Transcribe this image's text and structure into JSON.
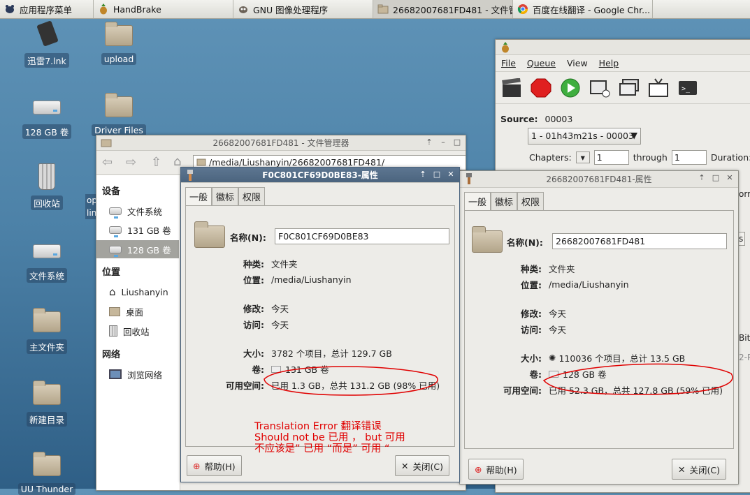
{
  "taskbar": {
    "menu": "应用程序菜单",
    "items": [
      "HandBrake",
      "GNU 图像处理程序",
      "26682007681FD481 - 文件管...",
      "百度在线翻译 - Google Chr..."
    ]
  },
  "desktop": {
    "icons": [
      "迅雷7.lnk",
      "upload",
      "128 GB 卷",
      "Driver Files",
      "回收站",
      "文件系统",
      "主文件夹",
      "新建目录",
      "UU Thunder"
    ],
    "partial": [
      "op",
      "lin"
    ]
  },
  "handbrake": {
    "menu": [
      "File",
      "Queue",
      "View",
      "Help"
    ],
    "source_label": "Source:",
    "source_value": "00003",
    "title_value": "1 - 01h43m21s - 00003",
    "chapters_label": "Chapters:",
    "chapter_from": "1",
    "through": "through",
    "chapter_to": "1",
    "duration": "Duration:",
    "right_partial": [
      "orm",
      "s",
      "Bitr",
      "2-P"
    ]
  },
  "fm": {
    "title": "26682007681FD481 - 文件管理器",
    "path": "/media/Liushanyin/26682007681FD481/",
    "sections": {
      "devices": "设备",
      "places": "位置",
      "network": "网络"
    },
    "devices": [
      "文件系统",
      "131 GB 卷",
      "128 GB 卷"
    ],
    "places": [
      "Liushanyin",
      "桌面",
      "回收站"
    ],
    "network": [
      "浏览网络"
    ]
  },
  "props1": {
    "title": "F0C801CF69D0BE83-属性",
    "tabs": [
      "一般",
      "徽标",
      "权限"
    ],
    "name_label": "名称(N):",
    "name_value": "F0C801CF69D0BE83",
    "kind_label": "种类:",
    "kind": "文件夹",
    "loc_label": "位置:",
    "loc": "/media/Liushanyin",
    "mod_label": "修改:",
    "mod": "今天",
    "acc_label": "访问:",
    "acc": "今天",
    "size_label": "大小:",
    "size": "3782 个项目，总计 129.7 GB",
    "vol_label": "卷:",
    "vol": "131 GB 卷",
    "free_label": "可用空间:",
    "free": "已用 1.3 GB，总共 131.2 GB (98% 已用)",
    "help": "帮助(H)",
    "close": "关闭(C)"
  },
  "props2": {
    "title": "26682007681FD481-属性",
    "tabs": [
      "一般",
      "徽标",
      "权限"
    ],
    "name_label": "名称(N):",
    "name_value": "26682007681FD481",
    "kind_label": "种类:",
    "kind": "文件夹",
    "loc_label": "位置:",
    "loc": "/media/Liushanyin",
    "mod_label": "修改:",
    "mod": "今天",
    "acc_label": "访问:",
    "acc": "今天",
    "size_label": "大小:",
    "size": "110036 个项目，总计 13.5 GB",
    "vol_label": "卷:",
    "vol": "128 GB 卷",
    "free_label": "可用空间:",
    "free": "已用 52.3 GB，总共 127.8 GB (59% 已用)",
    "help": "帮助(H)",
    "close": "关闭(C)"
  },
  "annotation": [
    "Translation Error 翻译错误",
    "Should not be 已用 ， but 可用",
    "不应该是” 已用 “而是” 可用 “"
  ],
  "colors": {
    "annotation": "#e00000",
    "active_title": "#4f6882"
  }
}
